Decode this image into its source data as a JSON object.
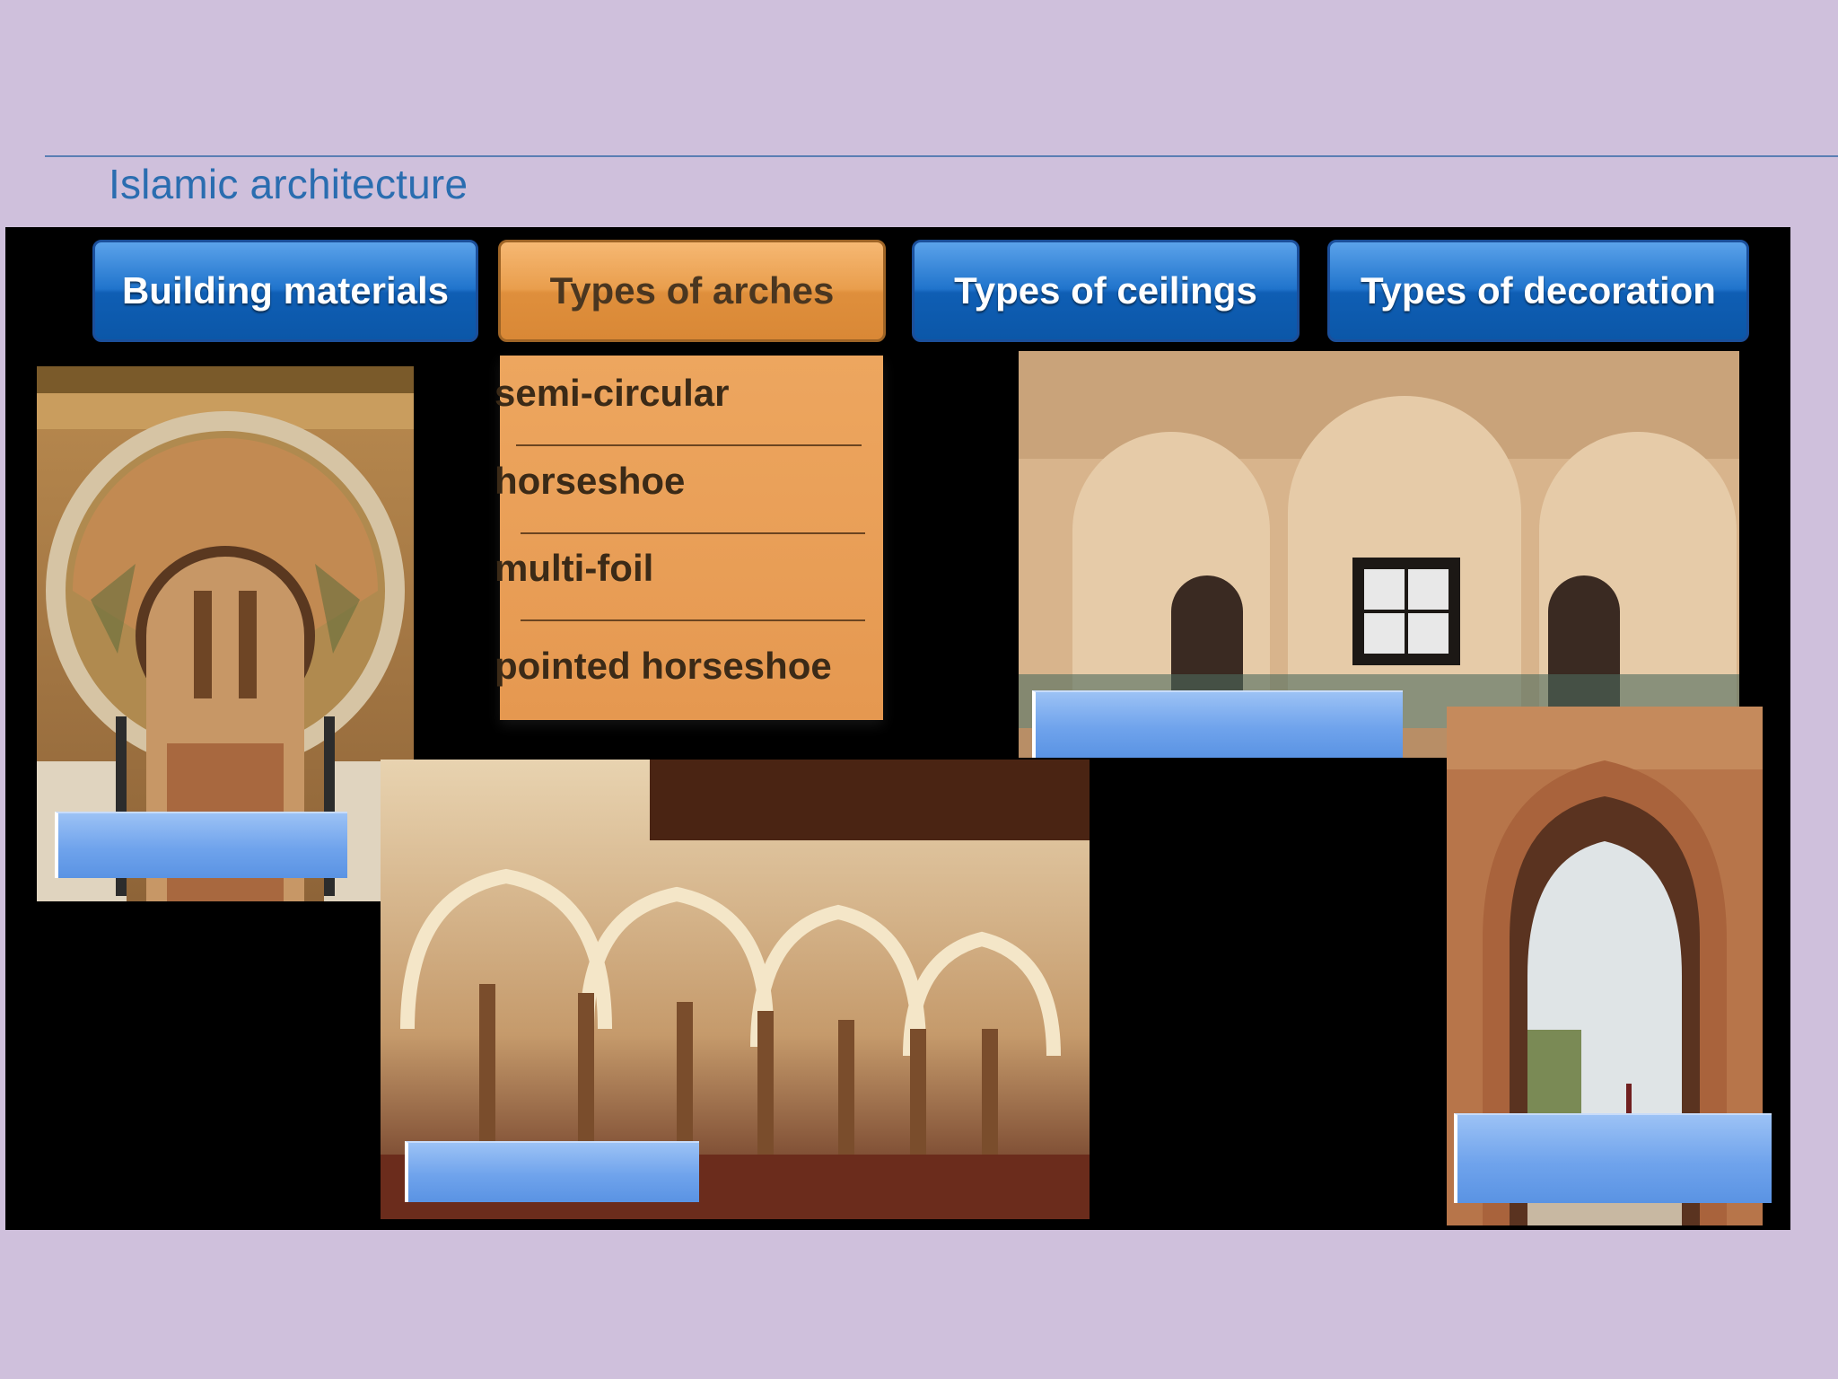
{
  "slide": {
    "title": "Islamic architecture"
  },
  "tabs": [
    {
      "label": "Building materials",
      "state": "normal"
    },
    {
      "label": "Types of arches",
      "state": "active"
    },
    {
      "label": "Types of ceilings",
      "state": "normal"
    },
    {
      "label": "Types of decoration",
      "state": "normal"
    }
  ],
  "arches_menu": {
    "items": [
      "semi-circular",
      "horseshoe",
      "multi-foil",
      "pointed horseshoe"
    ]
  },
  "photos": [
    {
      "icon": "horseshoe-arch-mihrab-photo"
    },
    {
      "icon": "multifoil-arcade-photo"
    },
    {
      "icon": "semicircular-arcade-photo"
    },
    {
      "icon": "pointed-horseshoe-gate-photo"
    }
  ],
  "answer_boxes": [
    "",
    "",
    "",
    ""
  ],
  "colors": {
    "background": "#cfc0dc",
    "title": "#2a6db0",
    "tab_blue": "#1f6fc8",
    "tab_orange": "#e99e4d",
    "answer_box": "#6fa3ec"
  }
}
